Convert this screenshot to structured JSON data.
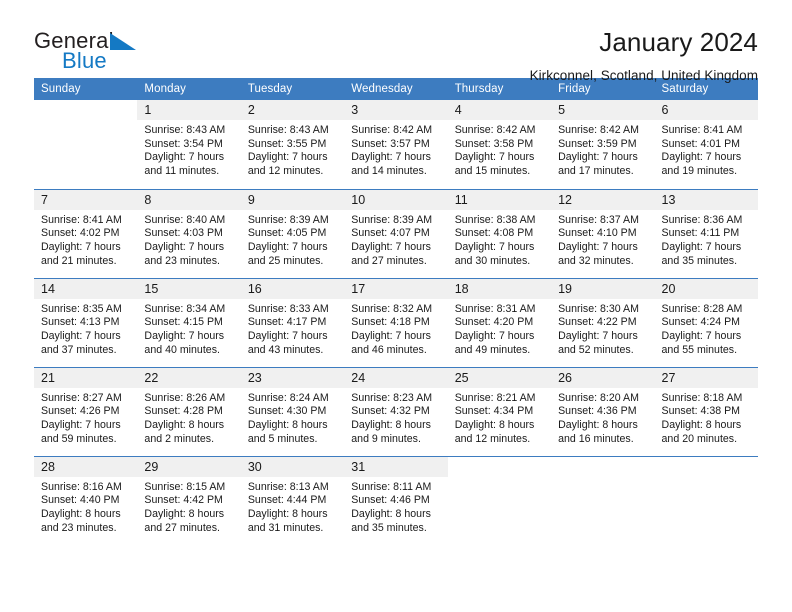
{
  "brand": {
    "word_one": "General",
    "word_two": "Blue",
    "flag_icon": "triangle-flag-icon",
    "blue": "#1479c4"
  },
  "header": {
    "title": "January 2024",
    "subtitle": "Kirkconnel, Scotland, United Kingdom"
  },
  "theme": {
    "header_blue": "#3d7cc0",
    "daynum_band": "#f0f0f0",
    "text": "#1a1a1a"
  },
  "weekday_headers": [
    "Sunday",
    "Monday",
    "Tuesday",
    "Wednesday",
    "Thursday",
    "Friday",
    "Saturday"
  ],
  "weeks": [
    [
      {
        "day": "",
        "blank": true,
        "sunrise": "",
        "sunset": "",
        "daylight_line1": "",
        "daylight_line2": ""
      },
      {
        "day": "1",
        "sunrise": "Sunrise: 8:43 AM",
        "sunset": "Sunset: 3:54 PM",
        "daylight_line1": "Daylight: 7 hours",
        "daylight_line2": "and 11 minutes."
      },
      {
        "day": "2",
        "sunrise": "Sunrise: 8:43 AM",
        "sunset": "Sunset: 3:55 PM",
        "daylight_line1": "Daylight: 7 hours",
        "daylight_line2": "and 12 minutes."
      },
      {
        "day": "3",
        "sunrise": "Sunrise: 8:42 AM",
        "sunset": "Sunset: 3:57 PM",
        "daylight_line1": "Daylight: 7 hours",
        "daylight_line2": "and 14 minutes."
      },
      {
        "day": "4",
        "sunrise": "Sunrise: 8:42 AM",
        "sunset": "Sunset: 3:58 PM",
        "daylight_line1": "Daylight: 7 hours",
        "daylight_line2": "and 15 minutes."
      },
      {
        "day": "5",
        "sunrise": "Sunrise: 8:42 AM",
        "sunset": "Sunset: 3:59 PM",
        "daylight_line1": "Daylight: 7 hours",
        "daylight_line2": "and 17 minutes."
      },
      {
        "day": "6",
        "sunrise": "Sunrise: 8:41 AM",
        "sunset": "Sunset: 4:01 PM",
        "daylight_line1": "Daylight: 7 hours",
        "daylight_line2": "and 19 minutes."
      }
    ],
    [
      {
        "day": "7",
        "sunrise": "Sunrise: 8:41 AM",
        "sunset": "Sunset: 4:02 PM",
        "daylight_line1": "Daylight: 7 hours",
        "daylight_line2": "and 21 minutes."
      },
      {
        "day": "8",
        "sunrise": "Sunrise: 8:40 AM",
        "sunset": "Sunset: 4:03 PM",
        "daylight_line1": "Daylight: 7 hours",
        "daylight_line2": "and 23 minutes."
      },
      {
        "day": "9",
        "sunrise": "Sunrise: 8:39 AM",
        "sunset": "Sunset: 4:05 PM",
        "daylight_line1": "Daylight: 7 hours",
        "daylight_line2": "and 25 minutes."
      },
      {
        "day": "10",
        "sunrise": "Sunrise: 8:39 AM",
        "sunset": "Sunset: 4:07 PM",
        "daylight_line1": "Daylight: 7 hours",
        "daylight_line2": "and 27 minutes."
      },
      {
        "day": "11",
        "sunrise": "Sunrise: 8:38 AM",
        "sunset": "Sunset: 4:08 PM",
        "daylight_line1": "Daylight: 7 hours",
        "daylight_line2": "and 30 minutes."
      },
      {
        "day": "12",
        "sunrise": "Sunrise: 8:37 AM",
        "sunset": "Sunset: 4:10 PM",
        "daylight_line1": "Daylight: 7 hours",
        "daylight_line2": "and 32 minutes."
      },
      {
        "day": "13",
        "sunrise": "Sunrise: 8:36 AM",
        "sunset": "Sunset: 4:11 PM",
        "daylight_line1": "Daylight: 7 hours",
        "daylight_line2": "and 35 minutes."
      }
    ],
    [
      {
        "day": "14",
        "sunrise": "Sunrise: 8:35 AM",
        "sunset": "Sunset: 4:13 PM",
        "daylight_line1": "Daylight: 7 hours",
        "daylight_line2": "and 37 minutes."
      },
      {
        "day": "15",
        "sunrise": "Sunrise: 8:34 AM",
        "sunset": "Sunset: 4:15 PM",
        "daylight_line1": "Daylight: 7 hours",
        "daylight_line2": "and 40 minutes."
      },
      {
        "day": "16",
        "sunrise": "Sunrise: 8:33 AM",
        "sunset": "Sunset: 4:17 PM",
        "daylight_line1": "Daylight: 7 hours",
        "daylight_line2": "and 43 minutes."
      },
      {
        "day": "17",
        "sunrise": "Sunrise: 8:32 AM",
        "sunset": "Sunset: 4:18 PM",
        "daylight_line1": "Daylight: 7 hours",
        "daylight_line2": "and 46 minutes."
      },
      {
        "day": "18",
        "sunrise": "Sunrise: 8:31 AM",
        "sunset": "Sunset: 4:20 PM",
        "daylight_line1": "Daylight: 7 hours",
        "daylight_line2": "and 49 minutes."
      },
      {
        "day": "19",
        "sunrise": "Sunrise: 8:30 AM",
        "sunset": "Sunset: 4:22 PM",
        "daylight_line1": "Daylight: 7 hours",
        "daylight_line2": "and 52 minutes."
      },
      {
        "day": "20",
        "sunrise": "Sunrise: 8:28 AM",
        "sunset": "Sunset: 4:24 PM",
        "daylight_line1": "Daylight: 7 hours",
        "daylight_line2": "and 55 minutes."
      }
    ],
    [
      {
        "day": "21",
        "sunrise": "Sunrise: 8:27 AM",
        "sunset": "Sunset: 4:26 PM",
        "daylight_line1": "Daylight: 7 hours",
        "daylight_line2": "and 59 minutes."
      },
      {
        "day": "22",
        "sunrise": "Sunrise: 8:26 AM",
        "sunset": "Sunset: 4:28 PM",
        "daylight_line1": "Daylight: 8 hours",
        "daylight_line2": "and 2 minutes."
      },
      {
        "day": "23",
        "sunrise": "Sunrise: 8:24 AM",
        "sunset": "Sunset: 4:30 PM",
        "daylight_line1": "Daylight: 8 hours",
        "daylight_line2": "and 5 minutes."
      },
      {
        "day": "24",
        "sunrise": "Sunrise: 8:23 AM",
        "sunset": "Sunset: 4:32 PM",
        "daylight_line1": "Daylight: 8 hours",
        "daylight_line2": "and 9 minutes."
      },
      {
        "day": "25",
        "sunrise": "Sunrise: 8:21 AM",
        "sunset": "Sunset: 4:34 PM",
        "daylight_line1": "Daylight: 8 hours",
        "daylight_line2": "and 12 minutes."
      },
      {
        "day": "26",
        "sunrise": "Sunrise: 8:20 AM",
        "sunset": "Sunset: 4:36 PM",
        "daylight_line1": "Daylight: 8 hours",
        "daylight_line2": "and 16 minutes."
      },
      {
        "day": "27",
        "sunrise": "Sunrise: 8:18 AM",
        "sunset": "Sunset: 4:38 PM",
        "daylight_line1": "Daylight: 8 hours",
        "daylight_line2": "and 20 minutes."
      }
    ],
    [
      {
        "day": "28",
        "sunrise": "Sunrise: 8:16 AM",
        "sunset": "Sunset: 4:40 PM",
        "daylight_line1": "Daylight: 8 hours",
        "daylight_line2": "and 23 minutes."
      },
      {
        "day": "29",
        "sunrise": "Sunrise: 8:15 AM",
        "sunset": "Sunset: 4:42 PM",
        "daylight_line1": "Daylight: 8 hours",
        "daylight_line2": "and 27 minutes."
      },
      {
        "day": "30",
        "sunrise": "Sunrise: 8:13 AM",
        "sunset": "Sunset: 4:44 PM",
        "daylight_line1": "Daylight: 8 hours",
        "daylight_line2": "and 31 minutes."
      },
      {
        "day": "31",
        "sunrise": "Sunrise: 8:11 AM",
        "sunset": "Sunset: 4:46 PM",
        "daylight_line1": "Daylight: 8 hours",
        "daylight_line2": "and 35 minutes."
      },
      {
        "day": "",
        "blank": true,
        "sunrise": "",
        "sunset": "",
        "daylight_line1": "",
        "daylight_line2": ""
      },
      {
        "day": "",
        "blank": true,
        "sunrise": "",
        "sunset": "",
        "daylight_line1": "",
        "daylight_line2": ""
      },
      {
        "day": "",
        "blank": true,
        "sunrise": "",
        "sunset": "",
        "daylight_line1": "",
        "daylight_line2": ""
      }
    ]
  ]
}
